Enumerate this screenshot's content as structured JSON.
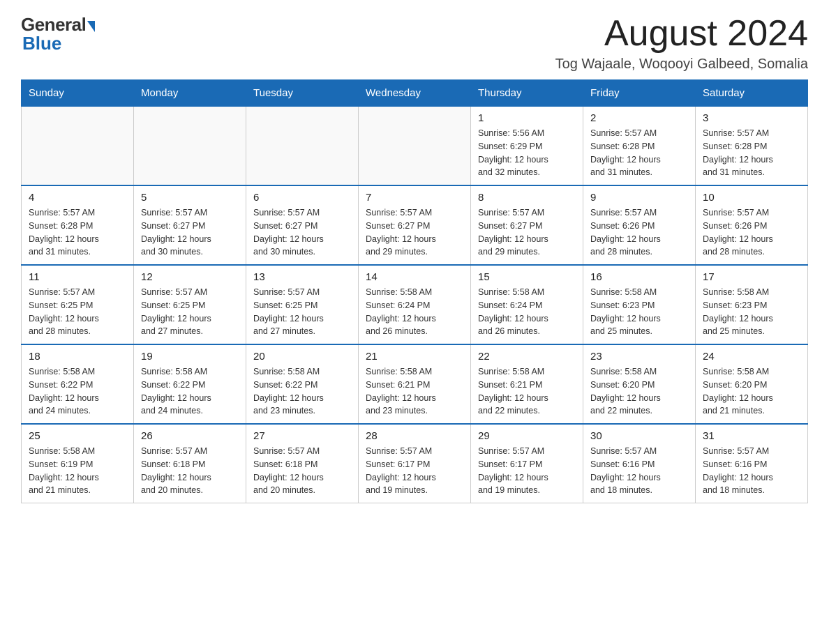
{
  "logo": {
    "text_general": "General",
    "text_blue": "Blue",
    "triangle": "▶"
  },
  "header": {
    "month_title": "August 2024",
    "subtitle": "Tog Wajaale, Woqooyi Galbeed, Somalia"
  },
  "weekdays": [
    "Sunday",
    "Monday",
    "Tuesday",
    "Wednesday",
    "Thursday",
    "Friday",
    "Saturday"
  ],
  "weeks": [
    [
      {
        "day": "",
        "info": ""
      },
      {
        "day": "",
        "info": ""
      },
      {
        "day": "",
        "info": ""
      },
      {
        "day": "",
        "info": ""
      },
      {
        "day": "1",
        "info": "Sunrise: 5:56 AM\nSunset: 6:29 PM\nDaylight: 12 hours\nand 32 minutes."
      },
      {
        "day": "2",
        "info": "Sunrise: 5:57 AM\nSunset: 6:28 PM\nDaylight: 12 hours\nand 31 minutes."
      },
      {
        "day": "3",
        "info": "Sunrise: 5:57 AM\nSunset: 6:28 PM\nDaylight: 12 hours\nand 31 minutes."
      }
    ],
    [
      {
        "day": "4",
        "info": "Sunrise: 5:57 AM\nSunset: 6:28 PM\nDaylight: 12 hours\nand 31 minutes."
      },
      {
        "day": "5",
        "info": "Sunrise: 5:57 AM\nSunset: 6:27 PM\nDaylight: 12 hours\nand 30 minutes."
      },
      {
        "day": "6",
        "info": "Sunrise: 5:57 AM\nSunset: 6:27 PM\nDaylight: 12 hours\nand 30 minutes."
      },
      {
        "day": "7",
        "info": "Sunrise: 5:57 AM\nSunset: 6:27 PM\nDaylight: 12 hours\nand 29 minutes."
      },
      {
        "day": "8",
        "info": "Sunrise: 5:57 AM\nSunset: 6:27 PM\nDaylight: 12 hours\nand 29 minutes."
      },
      {
        "day": "9",
        "info": "Sunrise: 5:57 AM\nSunset: 6:26 PM\nDaylight: 12 hours\nand 28 minutes."
      },
      {
        "day": "10",
        "info": "Sunrise: 5:57 AM\nSunset: 6:26 PM\nDaylight: 12 hours\nand 28 minutes."
      }
    ],
    [
      {
        "day": "11",
        "info": "Sunrise: 5:57 AM\nSunset: 6:25 PM\nDaylight: 12 hours\nand 28 minutes."
      },
      {
        "day": "12",
        "info": "Sunrise: 5:57 AM\nSunset: 6:25 PM\nDaylight: 12 hours\nand 27 minutes."
      },
      {
        "day": "13",
        "info": "Sunrise: 5:57 AM\nSunset: 6:25 PM\nDaylight: 12 hours\nand 27 minutes."
      },
      {
        "day": "14",
        "info": "Sunrise: 5:58 AM\nSunset: 6:24 PM\nDaylight: 12 hours\nand 26 minutes."
      },
      {
        "day": "15",
        "info": "Sunrise: 5:58 AM\nSunset: 6:24 PM\nDaylight: 12 hours\nand 26 minutes."
      },
      {
        "day": "16",
        "info": "Sunrise: 5:58 AM\nSunset: 6:23 PM\nDaylight: 12 hours\nand 25 minutes."
      },
      {
        "day": "17",
        "info": "Sunrise: 5:58 AM\nSunset: 6:23 PM\nDaylight: 12 hours\nand 25 minutes."
      }
    ],
    [
      {
        "day": "18",
        "info": "Sunrise: 5:58 AM\nSunset: 6:22 PM\nDaylight: 12 hours\nand 24 minutes."
      },
      {
        "day": "19",
        "info": "Sunrise: 5:58 AM\nSunset: 6:22 PM\nDaylight: 12 hours\nand 24 minutes."
      },
      {
        "day": "20",
        "info": "Sunrise: 5:58 AM\nSunset: 6:22 PM\nDaylight: 12 hours\nand 23 minutes."
      },
      {
        "day": "21",
        "info": "Sunrise: 5:58 AM\nSunset: 6:21 PM\nDaylight: 12 hours\nand 23 minutes."
      },
      {
        "day": "22",
        "info": "Sunrise: 5:58 AM\nSunset: 6:21 PM\nDaylight: 12 hours\nand 22 minutes."
      },
      {
        "day": "23",
        "info": "Sunrise: 5:58 AM\nSunset: 6:20 PM\nDaylight: 12 hours\nand 22 minutes."
      },
      {
        "day": "24",
        "info": "Sunrise: 5:58 AM\nSunset: 6:20 PM\nDaylight: 12 hours\nand 21 minutes."
      }
    ],
    [
      {
        "day": "25",
        "info": "Sunrise: 5:58 AM\nSunset: 6:19 PM\nDaylight: 12 hours\nand 21 minutes."
      },
      {
        "day": "26",
        "info": "Sunrise: 5:57 AM\nSunset: 6:18 PM\nDaylight: 12 hours\nand 20 minutes."
      },
      {
        "day": "27",
        "info": "Sunrise: 5:57 AM\nSunset: 6:18 PM\nDaylight: 12 hours\nand 20 minutes."
      },
      {
        "day": "28",
        "info": "Sunrise: 5:57 AM\nSunset: 6:17 PM\nDaylight: 12 hours\nand 19 minutes."
      },
      {
        "day": "29",
        "info": "Sunrise: 5:57 AM\nSunset: 6:17 PM\nDaylight: 12 hours\nand 19 minutes."
      },
      {
        "day": "30",
        "info": "Sunrise: 5:57 AM\nSunset: 6:16 PM\nDaylight: 12 hours\nand 18 minutes."
      },
      {
        "day": "31",
        "info": "Sunrise: 5:57 AM\nSunset: 6:16 PM\nDaylight: 12 hours\nand 18 minutes."
      }
    ]
  ]
}
